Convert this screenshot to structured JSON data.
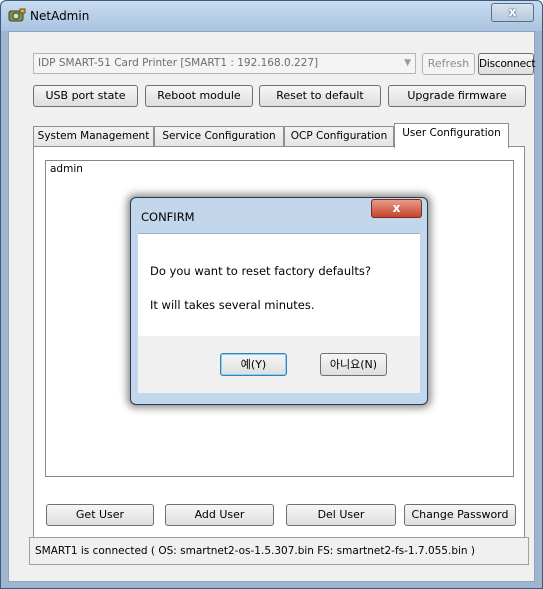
{
  "window": {
    "title": "NetAdmin",
    "close_label": "x"
  },
  "device": {
    "selected": "IDP SMART-51 Card Printer  [SMART1 : 192.168.0.227]",
    "refresh_label": "Refresh",
    "disconnect_label": "Disconnect"
  },
  "toolbar": {
    "usb_port_state": "USB port state",
    "reboot_module": "Reboot module",
    "reset_to_default": "Reset to default",
    "upgrade_firmware": "Upgrade firmware"
  },
  "tabs": [
    {
      "label": "System Management"
    },
    {
      "label": "Service Configuration"
    },
    {
      "label": "OCP Configuration"
    },
    {
      "label": "User Configuration"
    }
  ],
  "users": [
    "admin"
  ],
  "user_actions": {
    "get_user": "Get User",
    "add_user": "Add User",
    "del_user": "Del User",
    "change_password": "Change Password"
  },
  "status": "SMART1 is connected ( OS: smartnet2-os-1.5.307.bin  FS: smartnet2-fs-1.7.055.bin )",
  "dialog": {
    "title": "CONFIRM",
    "close_label": "x",
    "message_1": "Do you want to reset factory defaults?",
    "message_2": "It will takes several minutes.",
    "yes_label": "예(Y)",
    "no_label": "아니요(N)"
  }
}
